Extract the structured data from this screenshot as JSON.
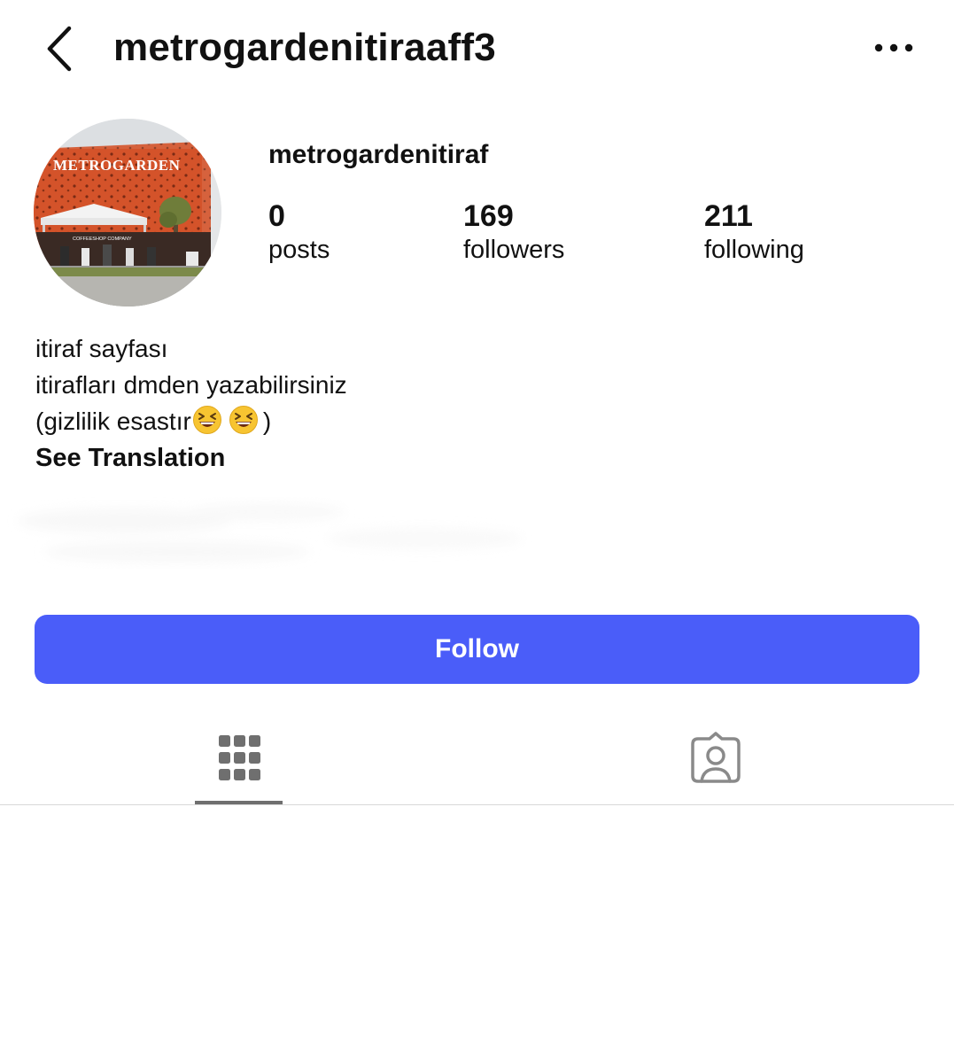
{
  "header": {
    "title": "metrogardenitiraaff3",
    "back_icon": "chevron-left-icon",
    "more_icon": "more-horizontal-icon"
  },
  "profile": {
    "avatar_sign_text": "METROGARDEN",
    "avatar_shop_text": "COFFEESHOP COMPANY",
    "name": "metrogardenitiraf",
    "stats": {
      "posts": {
        "count": "0",
        "label": "posts"
      },
      "followers": {
        "count": "169",
        "label": "followers"
      },
      "following": {
        "count": "211",
        "label": "following"
      }
    },
    "bio": {
      "line1": "itiraf sayfası",
      "line2": "itirafları dmden yazabilirsiniz",
      "line3_prefix": "(gizlilik esastır",
      "line3_suffix": ")",
      "emoji_name": "grinning-squinting-face-emoji",
      "see_translation": "See Translation"
    }
  },
  "actions": {
    "follow_label": "Follow",
    "follow_color": "#4a5df9"
  },
  "tabs": [
    {
      "name": "grid",
      "icon": "grid-icon",
      "active": true
    },
    {
      "name": "tagged",
      "icon": "tagged-person-icon",
      "active": false
    }
  ]
}
